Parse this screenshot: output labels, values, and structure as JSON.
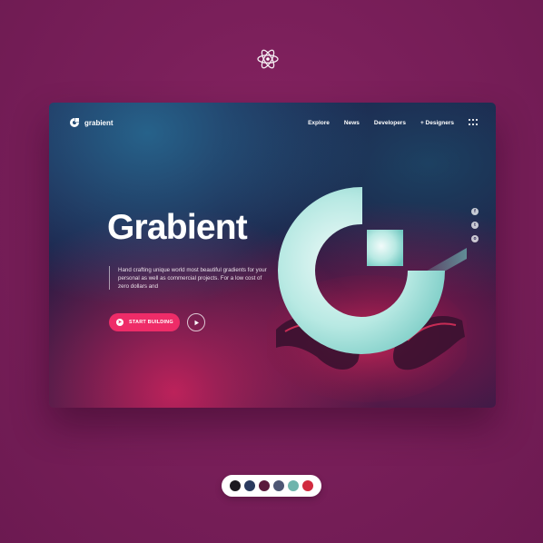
{
  "brand": {
    "name": "grabient"
  },
  "nav": {
    "items": [
      "Explore",
      "News",
      "Developers",
      "+ Designers"
    ]
  },
  "hero": {
    "title": "Grabient",
    "description": "Hand crafting unique world most beautiful gradients for your personal as well as commercial projects. For a low cost of zero dollars and",
    "cta_label": "START BUILDING"
  },
  "social": [
    "facebook-icon",
    "twitter-icon",
    "instagram-icon"
  ],
  "palette": [
    "#1c1a20",
    "#2a3a5e",
    "#5a1a3c",
    "#4d5674",
    "#6fb4ac",
    "#d12a3f"
  ],
  "colors": {
    "background": "#7a1f5a",
    "accent": "#ee2c68"
  }
}
